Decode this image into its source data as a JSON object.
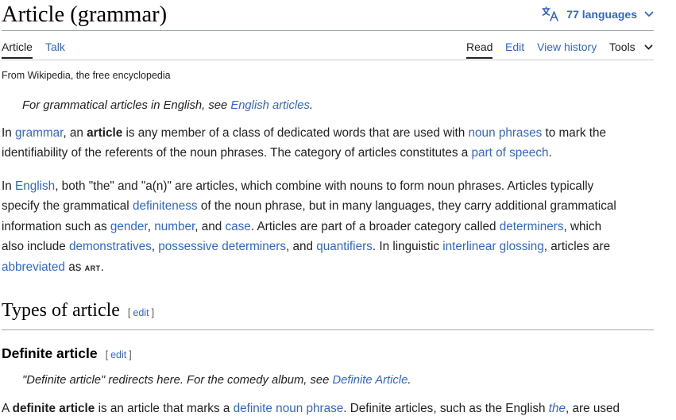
{
  "page": {
    "title": "Article (grammar)",
    "languages_label": "77 languages"
  },
  "tabs": {
    "article": "Article",
    "talk": "Talk",
    "read": "Read",
    "edit": "Edit",
    "view_history": "View history",
    "tools": "Tools"
  },
  "tagline": "From Wikipedia, the free encyclopedia",
  "hatnote1": {
    "text": "For grammatical articles in English, see ",
    "link": "English articles",
    "end": "."
  },
  "para1": {
    "l1_a": "In ",
    "l1_link_grammar": "grammar",
    "l1_b": ", an ",
    "l1_bold": "article",
    "l1_c": " is any member of a class of dedicated words that are used with ",
    "l1_link_np": "noun phrases",
    "l1_d": " to mark the",
    "l2_a": "identifiability of the referents of the noun phrases. The category of articles constitutes a ",
    "l2_link_pos": "part of speech",
    "l2_b": "."
  },
  "para2": {
    "l1_a": "In ",
    "l1_link_english": "English",
    "l1_b": ", both \"the\" and \"a(n)\" are articles, which combine with nouns to form noun phrases. Articles typically",
    "l2_a": "specify the grammatical ",
    "l2_link_def": "definiteness",
    "l2_b": " of the noun phrase, but in many languages, they carry additional grammatical",
    "l3_a": "information such as ",
    "l3_link_gender": "gender",
    "l3_b": ", ",
    "l3_link_number": "number",
    "l3_c": ", and ",
    "l3_link_case": "case",
    "l3_d": ". Articles are part of a broader category called ",
    "l3_link_det": "determiners",
    "l3_e": ", which",
    "l4_a": "also include ",
    "l4_link_dem": "demonstratives",
    "l4_b": ", ",
    "l4_link_poss": "possessive determiners",
    "l4_c": ", and ",
    "l4_link_quant": "quantifiers",
    "l4_d": ". In linguistic ",
    "l4_link_ilg": "interlinear glossing",
    "l4_e": ", articles are",
    "l5_link_abbr": "abbreviated",
    "l5_a": " as ",
    "l5_art": "art",
    "l5_b": "."
  },
  "section_types": {
    "heading": "Types of article",
    "edit": "edit",
    "open_bracket": "[",
    "close_bracket": "]"
  },
  "section_definite": {
    "heading": "Definite article",
    "edit": "edit",
    "open_bracket": "[",
    "close_bracket": "]"
  },
  "hatnote2": {
    "text": "\"Definite article\" redirects here. For the comedy album, see ",
    "link": "Definite Article",
    "end": "."
  },
  "para3": {
    "a": "A ",
    "bold": "definite article",
    "b": " is an article that marks a ",
    "link_dnp": "definite noun phrase",
    "c": ". Definite articles, such as the English ",
    "link_the": "the",
    "d": ", are used"
  },
  "colors": {
    "link": "#3366cc",
    "text": "#202122",
    "rule": "#a2a9b1"
  },
  "icons": {
    "language": "translate-icon",
    "chevron": "chevron-down-icon"
  }
}
